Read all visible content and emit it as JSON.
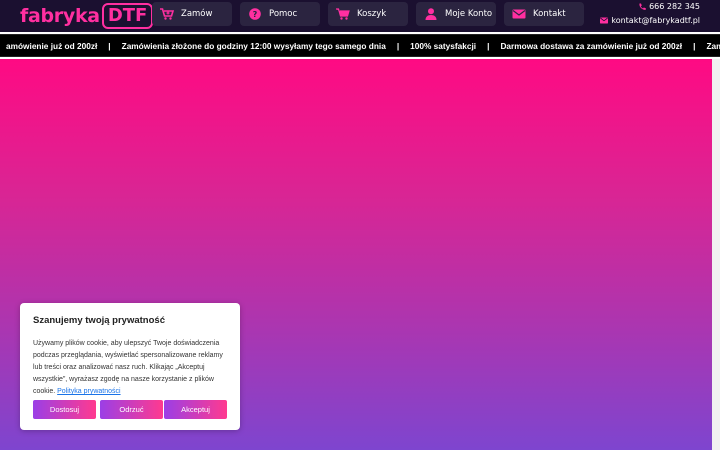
{
  "brand": {
    "word": "fabryka",
    "box": "DTF",
    "accent": "#ff2fa0"
  },
  "nav": {
    "items": [
      {
        "label": "Zamów",
        "icon": "cart-plus-icon"
      },
      {
        "label": "Pomoc",
        "icon": "question-circle-icon"
      },
      {
        "label": "Koszyk",
        "icon": "cart-icon"
      },
      {
        "label": "Moje Konto",
        "icon": "user-icon"
      },
      {
        "label": "Kontakt",
        "icon": "envelope-icon"
      }
    ]
  },
  "contact": {
    "phone": "666 282 345",
    "email": "kontakt@fabrykadtf.pl"
  },
  "ticker": {
    "items": [
      "amówienie już od 200zł",
      "Zamówienia złożone do godziny 12:00 wysyłamy tego samego dnia",
      "100% satysfakcji",
      "Darmowa dostawa za zamówienie już od 200zł",
      "Zamówienia złożone do"
    ],
    "separator": "|"
  },
  "hero": {
    "gradient_top": "#ff0a83",
    "gradient_bottom": "#7e45cf"
  },
  "cookie": {
    "title": "Szanujemy twoją prywatność",
    "text": "Używamy plików cookie, aby ulepszyć Twoje doświadczenia podczas przeglądania, wyświetlać spersonalizowane reklamy lub treści oraz analizować nasz ruch. Klikając „Akceptuj wszystkie”, wyrażasz zgodę na nasze korzystanie z plików cookie.",
    "link": "Polityka prywatności",
    "buttons": {
      "customize": "Dostosuj",
      "reject": "Odrzuć",
      "accept": "Akceptuj"
    }
  }
}
